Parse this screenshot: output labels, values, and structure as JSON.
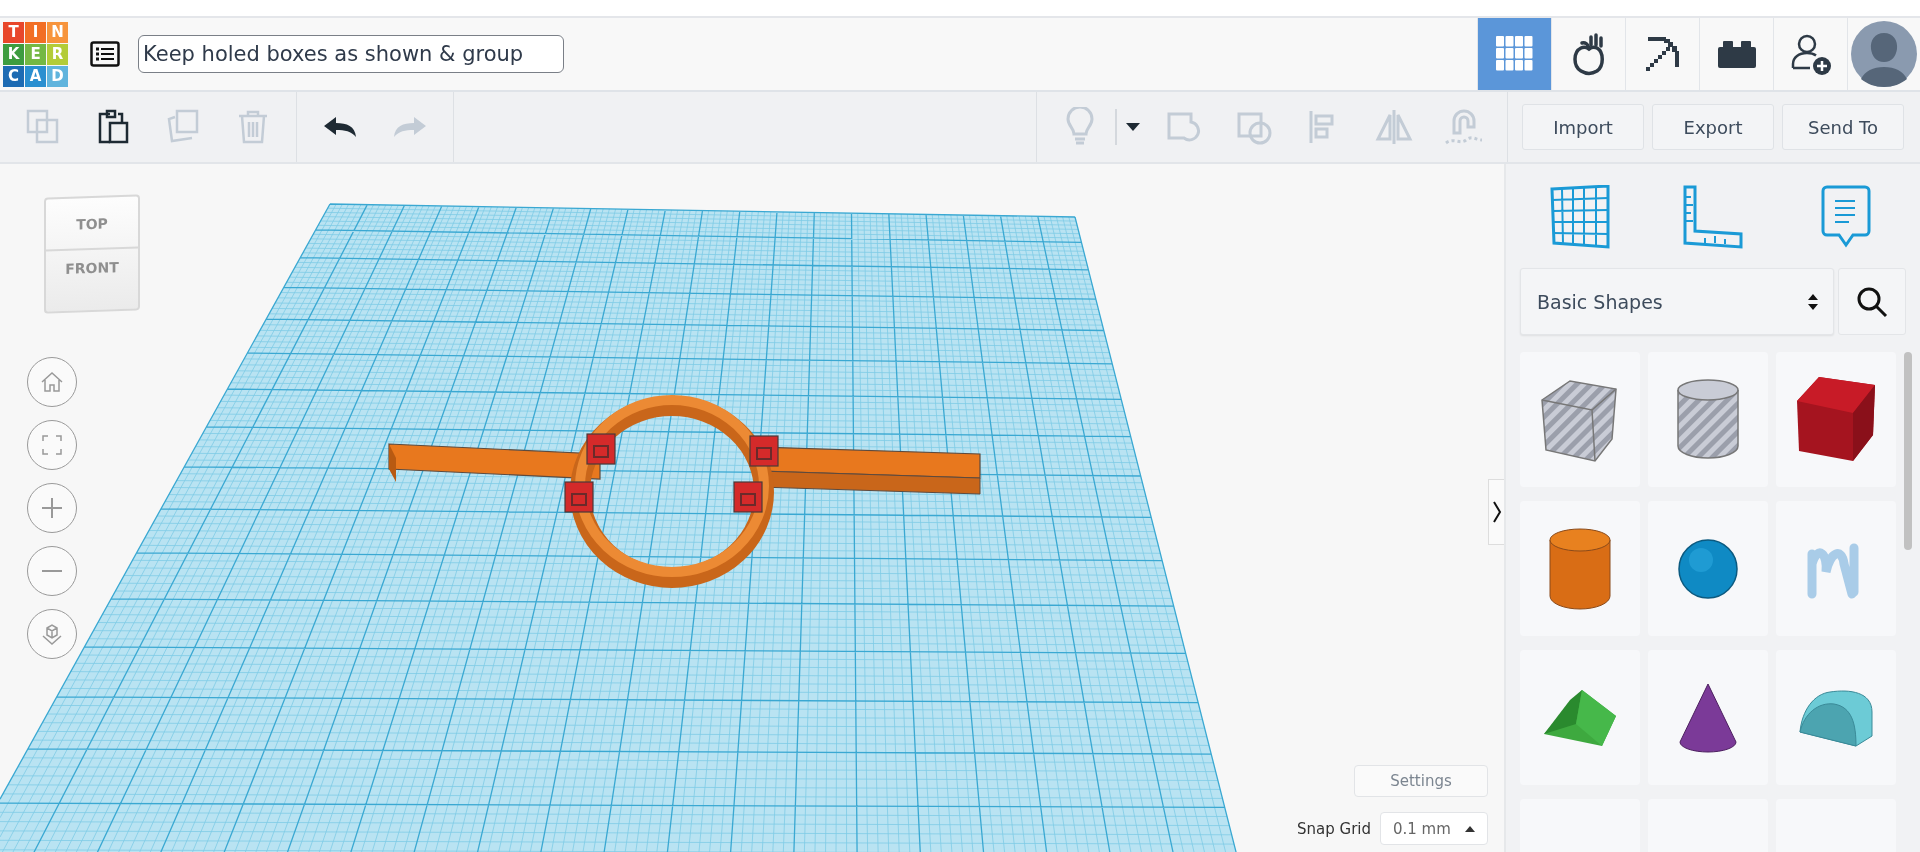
{
  "header": {
    "logo": [
      {
        "letter": "T",
        "color": "#e8472b"
      },
      {
        "letter": "I",
        "color": "#f26e24"
      },
      {
        "letter": "N",
        "color": "#f7943c"
      },
      {
        "letter": "K",
        "color": "#3d9c3f"
      },
      {
        "letter": "E",
        "color": "#74b844"
      },
      {
        "letter": "R",
        "color": "#b3cc38"
      },
      {
        "letter": "C",
        "color": "#1d6bb3"
      },
      {
        "letter": "A",
        "color": "#2a8fd0"
      },
      {
        "letter": "D",
        "color": "#60b4dd"
      }
    ],
    "design_title": "Keep holed boxes as shown & group",
    "view_tabs": [
      {
        "kind": "grid",
        "selected": true
      },
      {
        "kind": "blocks",
        "selected": false
      },
      {
        "kind": "pickaxe",
        "selected": false
      },
      {
        "kind": "brick",
        "selected": false
      },
      {
        "kind": "add-user",
        "selected": false
      }
    ]
  },
  "toolbar": {
    "edit_tools": [
      {
        "kind": "copy",
        "disabled": true
      },
      {
        "kind": "paste",
        "disabled": false
      },
      {
        "kind": "duplicate",
        "disabled": true
      },
      {
        "kind": "delete",
        "disabled": true
      }
    ],
    "history_tools": [
      {
        "kind": "undo",
        "disabled": false
      },
      {
        "kind": "redo",
        "disabled": true
      }
    ],
    "shape_tools": [
      {
        "kind": "light",
        "disabled": true
      },
      {
        "kind": "dropdown",
        "disabled": false
      },
      {
        "kind": "group",
        "disabled": true
      },
      {
        "kind": "ungroup",
        "disabled": true
      },
      {
        "kind": "align",
        "disabled": true
      },
      {
        "kind": "mirror",
        "disabled": true
      },
      {
        "kind": "magnet",
        "disabled": true
      }
    ],
    "actions": [
      "Import",
      "Export",
      "Send To"
    ]
  },
  "view_cube": {
    "top": "TOP",
    "front": "FRONT"
  },
  "view_controls": [
    {
      "kind": "home"
    },
    {
      "kind": "fit"
    },
    {
      "kind": "zoom-in"
    },
    {
      "kind": "zoom-out"
    },
    {
      "kind": "perspective"
    }
  ],
  "settings_button": "Settings",
  "snap_grid": {
    "label": "Snap Grid",
    "value": "0.1 mm"
  },
  "panel": {
    "panel_tabs": [
      {
        "kind": "workplane"
      },
      {
        "kind": "ruler"
      },
      {
        "kind": "notes"
      }
    ],
    "shape_library": "Basic Shapes",
    "shapes": [
      {
        "kind": "box-hole"
      },
      {
        "kind": "cylinder-hole"
      },
      {
        "kind": "box"
      },
      {
        "kind": "cylinder"
      },
      {
        "kind": "sphere"
      },
      {
        "kind": "scribble"
      },
      {
        "kind": "roof"
      },
      {
        "kind": "cone"
      },
      {
        "kind": "round-roof"
      }
    ]
  }
}
